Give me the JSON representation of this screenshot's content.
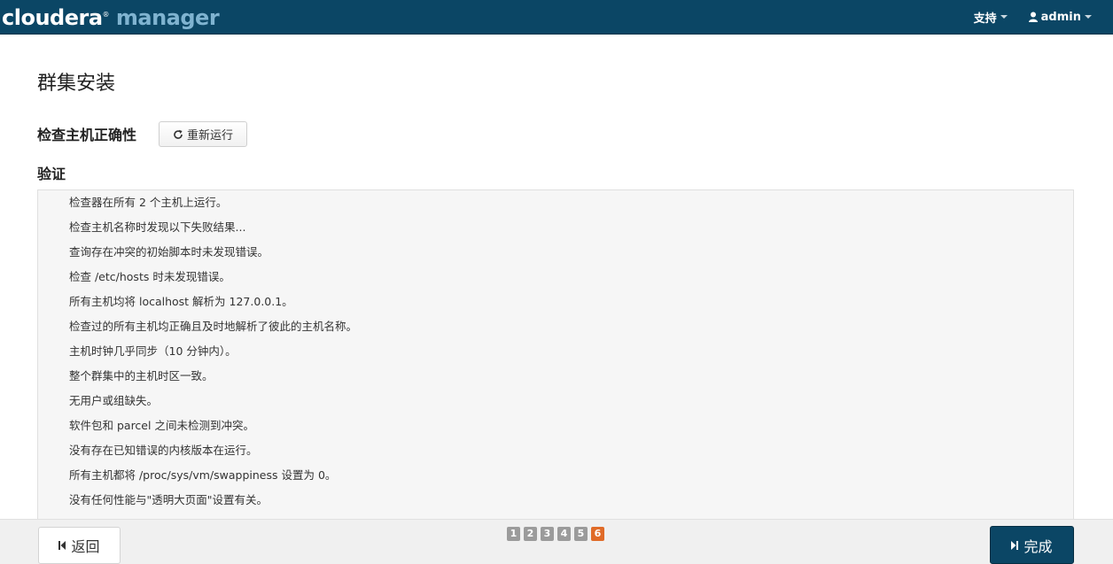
{
  "header": {
    "logo_primary": "cloudera",
    "logo_mark": "®",
    "logo_secondary": " manager",
    "support_label": "支持",
    "user_label": "admin"
  },
  "page": {
    "title": "群集安装",
    "section_title": "检查主机正确性",
    "rerun_label": "重新运行",
    "verify_title": "验证"
  },
  "results": [
    "检查器在所有 2 个主机上运行。",
    "检查主机名称时发现以下失败结果...",
    "查询存在冲突的初始脚本时未发现错误。",
    "检查 /etc/hosts 时未发现错误。",
    "所有主机均将 localhost 解析为 127.0.0.1。",
    "检查过的所有主机均正确且及时地解析了彼此的主机名称。",
    "主机时钟几乎同步（10 分钟内）。",
    "整个群集中的主机时区一致。",
    "无用户或组缺失。",
    "软件包和 parcel 之间未检测到冲突。",
    "没有存在已知错误的内核版本在运行。",
    "所有主机都将 /proc/sys/vm/swappiness 设置为 0。",
    "没有任何性能与\"透明大页面\"设置有关。"
  ],
  "footer": {
    "back_label": "返回",
    "finish_label": "完成",
    "steps": [
      "1",
      "2",
      "3",
      "4",
      "5",
      "6"
    ],
    "active_step": "6"
  },
  "colors": {
    "header_bg": "#0b4665",
    "primary_button": "#0b4665",
    "active_step": "#e06b28",
    "inactive_step": "#9b9b9b"
  }
}
